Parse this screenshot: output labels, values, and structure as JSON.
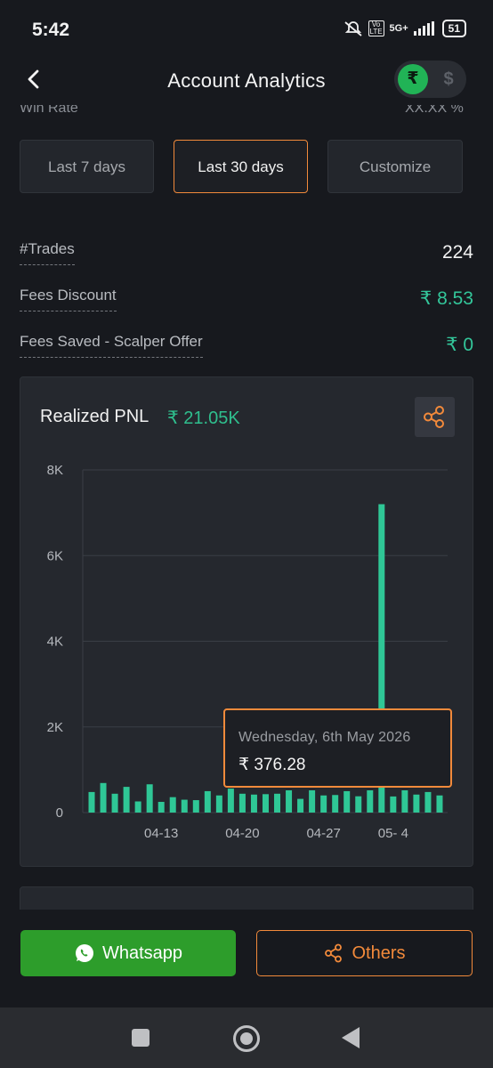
{
  "status_bar": {
    "time": "5:42",
    "network": "5G+",
    "volte": "Vo LTE",
    "battery": "51"
  },
  "header": {
    "title": "Account Analytics",
    "inr_symbol": "₹",
    "usd_symbol": "$",
    "cut_left": "Win Rate",
    "cut_right": "XX.XX %"
  },
  "period_tabs": [
    {
      "label": "Last 7 days",
      "active": false
    },
    {
      "label": "Last 30 days",
      "active": true
    },
    {
      "label": "Customize",
      "active": false
    }
  ],
  "stats": [
    {
      "label": "#Trades",
      "value": "224"
    },
    {
      "label": "Fees Discount",
      "value": "₹ 8.53"
    },
    {
      "label": "Fees Saved - Scalper Offer",
      "value": "₹ 0"
    }
  ],
  "pnl_card": {
    "title": "Realized PNL",
    "total": "₹ 21.05K"
  },
  "tooltip": {
    "date": "Wednesday, 6th May 2026",
    "value": "₹  376.28"
  },
  "chart_data": {
    "type": "bar",
    "title": "Realized PNL",
    "ylim": [
      0,
      8000
    ],
    "y_ticks": [
      "0",
      "2K",
      "4K",
      "6K",
      "8K"
    ],
    "x_tick_labels": [
      "04-13",
      "04-20",
      "04-27",
      "05- 4"
    ],
    "x_tick_indices": [
      6,
      13,
      20,
      26
    ],
    "bar_color": "#2fc796",
    "values": [
      480,
      690,
      440,
      600,
      260,
      660,
      250,
      360,
      300,
      290,
      500,
      400,
      560,
      440,
      420,
      430,
      440,
      520,
      320,
      520,
      400,
      410,
      500,
      380,
      520,
      7200,
      376,
      520,
      420,
      480,
      400
    ]
  },
  "actions": {
    "whatsapp": "Whatsapp",
    "others": "Others"
  }
}
